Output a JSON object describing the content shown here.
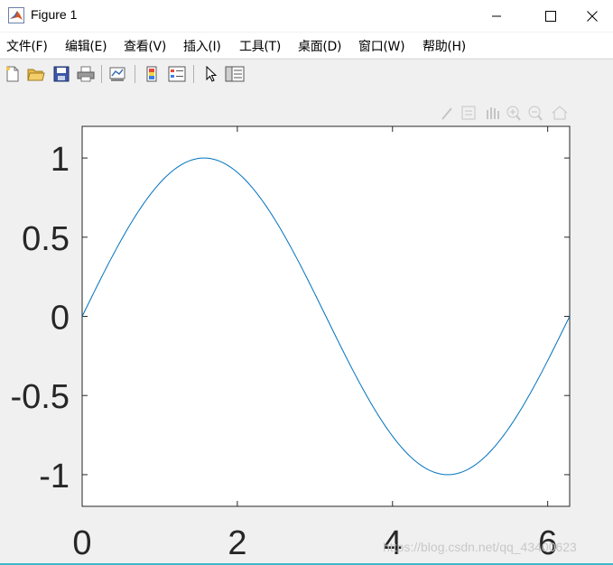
{
  "window": {
    "title": "Figure 1",
    "icon": "matlab-logo-icon"
  },
  "menu": {
    "items": [
      {
        "label": "文件(F)"
      },
      {
        "label": "编辑(E)"
      },
      {
        "label": "查看(V)"
      },
      {
        "label": "插入(I)"
      },
      {
        "label": "工具(T)"
      },
      {
        "label": "桌面(D)"
      },
      {
        "label": "窗口(W)"
      },
      {
        "label": "帮助(H)"
      }
    ]
  },
  "toolbar": {
    "icons": [
      "new-figure-icon",
      "open-file-icon",
      "save-icon",
      "print-icon",
      "link-plot-icon",
      "colorbar-icon",
      "legend-icon",
      "pointer-icon",
      "property-inspector-icon"
    ]
  },
  "axes_toolbar": {
    "icons": [
      "brush-icon",
      "data-tips-icon",
      "pan-icon",
      "zoom-in-icon",
      "zoom-out-icon",
      "home-icon"
    ]
  },
  "colors": {
    "line": "#0072bd",
    "axes_bg": "#ffffff",
    "figure_bg": "#f0f0f0",
    "tick_text": "#262626"
  },
  "chart_data": {
    "type": "line",
    "function": "sin(x)",
    "x_range": [
      0,
      6.2832
    ],
    "xlim": [
      0,
      6.2832
    ],
    "ylim": [
      -1.2,
      1.2
    ],
    "xticks": [
      0,
      2,
      4,
      6
    ],
    "xtick_labels": [
      "0",
      "2",
      "4",
      "6"
    ],
    "yticks": [
      1,
      0.5,
      0,
      -0.5,
      -1
    ],
    "ytick_labels": [
      "1",
      "0.5",
      "0",
      "-0.5",
      "-1"
    ],
    "grid": false,
    "series": [
      {
        "x": [
          0,
          0.2618,
          0.5236,
          0.7854,
          1.0472,
          1.309,
          1.5708,
          1.8326,
          2.0944,
          2.3562,
          2.618,
          2.8798,
          3.1416,
          3.4034,
          3.6652,
          3.927,
          4.1888,
          4.4506,
          4.7124,
          4.9742,
          5.236,
          5.4978,
          5.7596,
          6.0214,
          6.2832
        ],
        "y": [
          0,
          0.2588,
          0.5,
          0.7071,
          0.866,
          0.9659,
          1,
          0.9659,
          0.866,
          0.7071,
          0.5,
          0.2588,
          0,
          -0.2588,
          -0.5,
          -0.7071,
          -0.866,
          -0.9659,
          -1,
          -0.9659,
          -0.866,
          -0.7071,
          -0.5,
          -0.2588,
          0
        ]
      }
    ]
  },
  "watermark": "https://blog.csdn.net/qq_43400623"
}
